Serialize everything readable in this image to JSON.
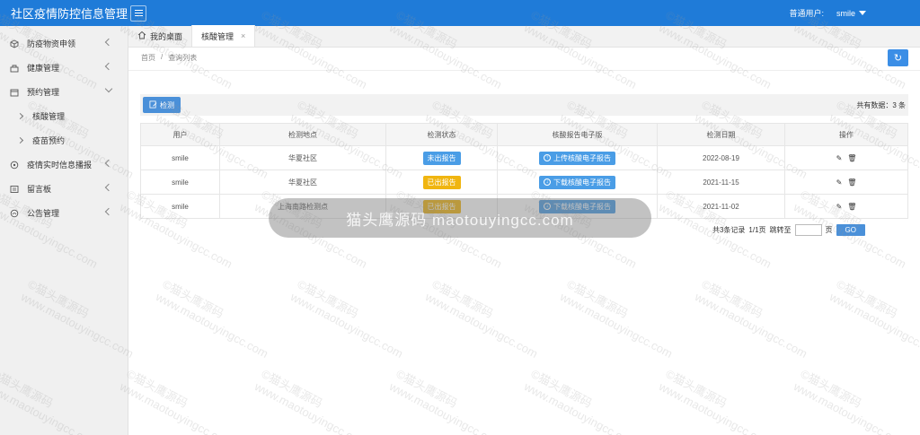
{
  "header": {
    "app_title": "社区疫情防控信息管理系",
    "user_role": "普通用户:",
    "username": "smile"
  },
  "sidebar": {
    "items": [
      {
        "label": "防疫物资申领",
        "icon": "cube-icon",
        "expanded": false
      },
      {
        "label": "健康管理",
        "icon": "heart-icon",
        "expanded": false
      },
      {
        "label": "预约管理",
        "icon": "calendar-icon",
        "expanded": true
      },
      {
        "label": "疫情实时信息播报",
        "icon": "broadcast-icon",
        "expanded": false
      },
      {
        "label": "留言板",
        "icon": "message-icon",
        "expanded": false
      },
      {
        "label": "公告管理",
        "icon": "notice-icon",
        "expanded": false
      }
    ],
    "sub_items": [
      {
        "label": "核酸管理"
      },
      {
        "label": "疫苗预约"
      }
    ]
  },
  "tabs": [
    {
      "label": "我的桌面",
      "icon": "home-icon"
    },
    {
      "label": "核酸管理",
      "close": "×"
    }
  ],
  "breadcrumb": {
    "home": "首页",
    "separator": "/",
    "current": "查询列表"
  },
  "toolbar": {
    "detect_label": "检测",
    "total_label": "共有数据：3 条"
  },
  "table": {
    "headers": [
      "用户",
      "检测地点",
      "检测状态",
      "核酸报告电子版",
      "检测日期",
      "操作"
    ],
    "rows": [
      {
        "user": "smile",
        "location": "华夏社区",
        "status": "未出报告",
        "status_color": "#4a9de6",
        "report": "上传核酸电子报告",
        "report_icon": "upload-icon",
        "date": "2022-08-19"
      },
      {
        "user": "smile",
        "location": "华夏社区",
        "status": "已出报告",
        "status_color": "#f0b510",
        "report": "下载核酸电子报告",
        "report_icon": "download-icon",
        "date": "2021-11-15"
      },
      {
        "user": "smile",
        "location": "上海南路检测点",
        "status": "已出报告",
        "status_color": "#f0b510",
        "report": "下载核酸电子报告",
        "report_icon": "download-icon",
        "date": "2021-11-02"
      }
    ]
  },
  "pager": {
    "records": "共3条记录",
    "pages": "1/1页",
    "jump_label": "跳转至",
    "page_unit": "页",
    "go_label": "GO"
  },
  "watermark": {
    "line1": "©猫头鹰源码",
    "line2": "www.maotouyingcc.com",
    "center": "猫头鹰源码 maotouyingcc.com"
  }
}
